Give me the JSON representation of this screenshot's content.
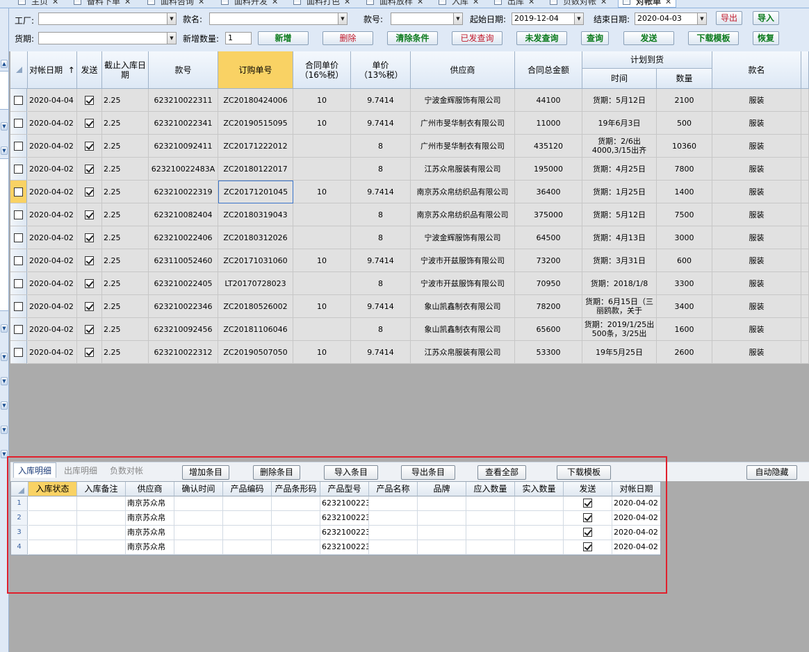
{
  "tabs": [
    {
      "label": "主页"
    },
    {
      "label": "备料下单"
    },
    {
      "label": "面料咨询"
    },
    {
      "label": "面料开发"
    },
    {
      "label": "面料打色"
    },
    {
      "label": "面料放样"
    },
    {
      "label": "入库"
    },
    {
      "label": "出库"
    },
    {
      "label": "负数对帐"
    },
    {
      "label": "对帐单"
    }
  ],
  "filters": {
    "factory_label": "工厂:",
    "factory_value": "",
    "style_name_label": "款名:",
    "style_name_value": "",
    "style_no_label": "款号:",
    "style_no_value": "",
    "start_date_label": "起始日期:",
    "start_date_value": "2019-12-04",
    "end_date_label": "结束日期:",
    "end_date_value": "2020-04-03",
    "delivery_label": "货期:",
    "delivery_value": "",
    "add_count_label": "新增数量:",
    "add_count_value": "1"
  },
  "toolbar": {
    "export": "导出",
    "import": "导入",
    "add": "新增",
    "delete": "删除",
    "clear": "清除条件",
    "sent_query": "已发查询",
    "unsent_query": "未发查询",
    "query": "查询",
    "send": "发送",
    "download_template": "下载模板",
    "restore": "恢复"
  },
  "main_grid": {
    "headers": {
      "date": "对帐日期",
      "sort_arrow": "↑",
      "send": "发送",
      "deadline": "截止入库日期",
      "style_no": "款号",
      "order_no": "订购单号",
      "contract_price": "合同单价（16%税）",
      "unit_price": "单价（13%税）",
      "supplier": "供应商",
      "total": "合同总金额",
      "plan_group": "计划到货",
      "plan_time": "时间",
      "plan_qty": "数量",
      "style_name": "款名"
    },
    "rows": [
      {
        "date": "2020-04-04",
        "sent": true,
        "deadline": "2.25",
        "style_no": "623210022311",
        "order_no": "ZC20180424006",
        "contract_price": "10",
        "unit_price": "9.7414",
        "supplier": "宁波金辉服饰有限公司",
        "total": "44100",
        "plan_time": "货期：5月12日",
        "plan_qty": "2100",
        "style_name": "服装"
      },
      {
        "date": "2020-04-02",
        "sent": true,
        "deadline": "2.25",
        "style_no": "623210022341",
        "order_no": "ZC20190515095",
        "contract_price": "10",
        "unit_price": "9.7414",
        "supplier": "广州市旻华制衣有限公司",
        "total": "11000",
        "plan_time": "19年6月3日",
        "plan_qty": "500",
        "style_name": "服装"
      },
      {
        "date": "2020-04-02",
        "sent": true,
        "deadline": "2.25",
        "style_no": "623210092411",
        "order_no": "ZC20171222012",
        "contract_price": "",
        "unit_price": "8",
        "supplier": "广州市旻华制衣有限公司",
        "total": "435120",
        "plan_time": "货期：2/6出4000,3/15出齐",
        "plan_qty": "10360",
        "style_name": "服装"
      },
      {
        "date": "2020-04-02",
        "sent": true,
        "deadline": "2.25",
        "style_no": "623210022483A",
        "order_no": "ZC20180122017",
        "contract_price": "",
        "unit_price": "8",
        "supplier": "江苏众帛服装有限公司",
        "total": "195000",
        "plan_time": "货期：4月25日",
        "plan_qty": "7800",
        "style_name": "服装"
      },
      {
        "date": "2020-04-02",
        "sent": true,
        "deadline": "2.25",
        "style_no": "623210022319",
        "order_no": "ZC20171201045",
        "contract_price": "10",
        "unit_price": "9.7414",
        "supplier": "南京苏众帛纺织品有限公司",
        "total": "36400",
        "plan_time": "货期：1月25日",
        "plan_qty": "1400",
        "style_name": "服装"
      },
      {
        "date": "2020-04-02",
        "sent": true,
        "deadline": "2.25",
        "style_no": "623210082404",
        "order_no": "ZC20180319043",
        "contract_price": "",
        "unit_price": "8",
        "supplier": "南京苏众帛纺织品有限公司",
        "total": "375000",
        "plan_time": "货期：5月12日",
        "plan_qty": "7500",
        "style_name": "服装"
      },
      {
        "date": "2020-04-02",
        "sent": true,
        "deadline": "2.25",
        "style_no": "623210022406",
        "order_no": "ZC20180312026",
        "contract_price": "",
        "unit_price": "8",
        "supplier": "宁波金辉服饰有限公司",
        "total": "64500",
        "plan_time": "货期：4月13日",
        "plan_qty": "3000",
        "style_name": "服装"
      },
      {
        "date": "2020-04-02",
        "sent": true,
        "deadline": "2.25",
        "style_no": "623110052460",
        "order_no": "ZC20171031060",
        "contract_price": "10",
        "unit_price": "9.7414",
        "supplier": "宁波市开兹服饰有限公司",
        "total": "73200",
        "plan_time": "货期：3月31日",
        "plan_qty": "600",
        "style_name": "服装"
      },
      {
        "date": "2020-04-02",
        "sent": true,
        "deadline": "2.25",
        "style_no": "623210022405",
        "order_no": "LT20170728023",
        "contract_price": "",
        "unit_price": "8",
        "supplier": "宁波市开兹服饰有限公司",
        "total": "70950",
        "plan_time": "货期：2018/1/8",
        "plan_qty": "3300",
        "style_name": "服装"
      },
      {
        "date": "2020-04-02",
        "sent": true,
        "deadline": "2.25",
        "style_no": "623210022346",
        "order_no": "ZC20180526002",
        "contract_price": "10",
        "unit_price": "9.7414",
        "supplier": "象山凯鑫制衣有限公司",
        "total": "78200",
        "plan_time": "货期：6月15日（三丽鸥款，关于",
        "plan_qty": "3400",
        "style_name": "服装"
      },
      {
        "date": "2020-04-02",
        "sent": true,
        "deadline": "2.25",
        "style_no": "623210092456",
        "order_no": "ZC20181106046",
        "contract_price": "",
        "unit_price": "8",
        "supplier": "象山凯鑫制衣有限公司",
        "total": "65600",
        "plan_time": "货期：2019/1/25出500条，3/25出",
        "plan_qty": "1600",
        "style_name": "服装"
      },
      {
        "date": "2020-04-02",
        "sent": true,
        "deadline": "2.25",
        "style_no": "623210022312",
        "order_no": "ZC20190507050",
        "contract_price": "10",
        "unit_price": "9.7414",
        "supplier": "江苏众帛服装有限公司",
        "total": "53300",
        "plan_time": "19年5月25日",
        "plan_qty": "2600",
        "style_name": "服装"
      }
    ]
  },
  "bottom_panel": {
    "tabs": {
      "in_detail": "入库明细",
      "out_detail": "出库明细",
      "negative": "负数对帐"
    },
    "buttons": {
      "add_item": "增加条目",
      "delete_item": "删除条目",
      "import_item": "导入条目",
      "export_item": "导出条目",
      "view_all": "查看全部",
      "download_template": "下载模板",
      "auto_hide": "自动隐藏"
    },
    "headers": [
      "入库状态",
      "入库备注",
      "供应商",
      "确认时间",
      "产品编码",
      "产品条形码",
      "产品型号",
      "产品名称",
      "品牌",
      "应入数量",
      "实入数量",
      "发送",
      "对帐日期"
    ],
    "rows": [
      {
        "num": "1",
        "supplier": "南京苏众帛",
        "model": "6232100223",
        "sent": true,
        "date": "2020-04-02"
      },
      {
        "num": "2",
        "supplier": "南京苏众帛",
        "model": "6232100223",
        "sent": true,
        "date": "2020-04-02"
      },
      {
        "num": "3",
        "supplier": "南京苏众帛",
        "model": "6232100223",
        "sent": true,
        "date": "2020-04-02"
      },
      {
        "num": "4",
        "supplier": "南京苏众帛",
        "model": "6232100223",
        "sent": true,
        "date": "2020-04-02"
      }
    ]
  },
  "colors": {
    "highlight_header": "#f9d264",
    "annotation_box": "#e0202c",
    "button_green": "#0b7a1c",
    "button_red": "#c0182a"
  }
}
